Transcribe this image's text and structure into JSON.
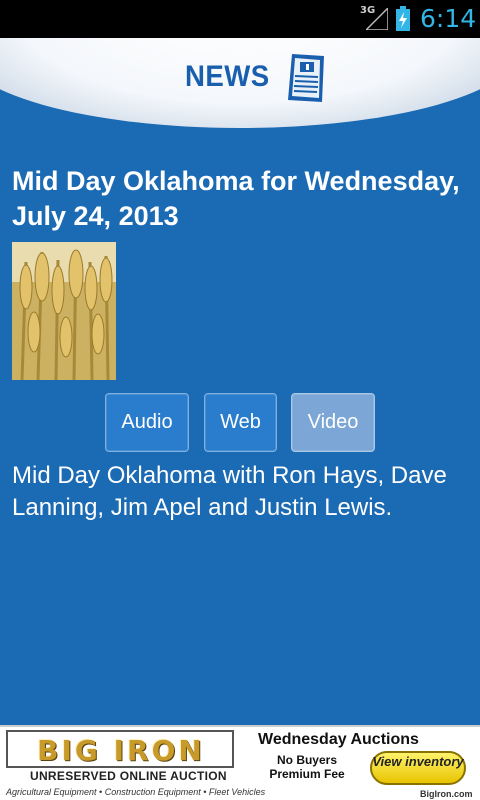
{
  "status_bar": {
    "network": "3G",
    "time": "6:14",
    "signal_icon": "signal-icon",
    "battery_icon": "battery-charging-icon"
  },
  "header": {
    "title": "NEWS",
    "icon": "newspaper-icon"
  },
  "article": {
    "title": "Mid Day Oklahoma for Wednesday, July 24, 2013",
    "image": "wheat-photo",
    "description": "Mid Day Oklahoma with Ron Hays, Dave Lanning, Jim Apel and Justin Lewis."
  },
  "buttons": {
    "audio": "Audio",
    "web": "Web",
    "video": "Video"
  },
  "ad": {
    "logo": "BIG IRON",
    "tagline": "UNRESERVED ONLINE AUCTION",
    "categories": "Agricultural Equipment • Construction Equipment • Fleet Vehicles",
    "headline": "Wednesday Auctions",
    "offer": "No Buyers Premium Fee",
    "cta": "View inventory",
    "site": "BigIron.com"
  },
  "colors": {
    "background": "#1b6ab4",
    "status_accent": "#33b5e5",
    "header_text": "#1a5fae"
  }
}
